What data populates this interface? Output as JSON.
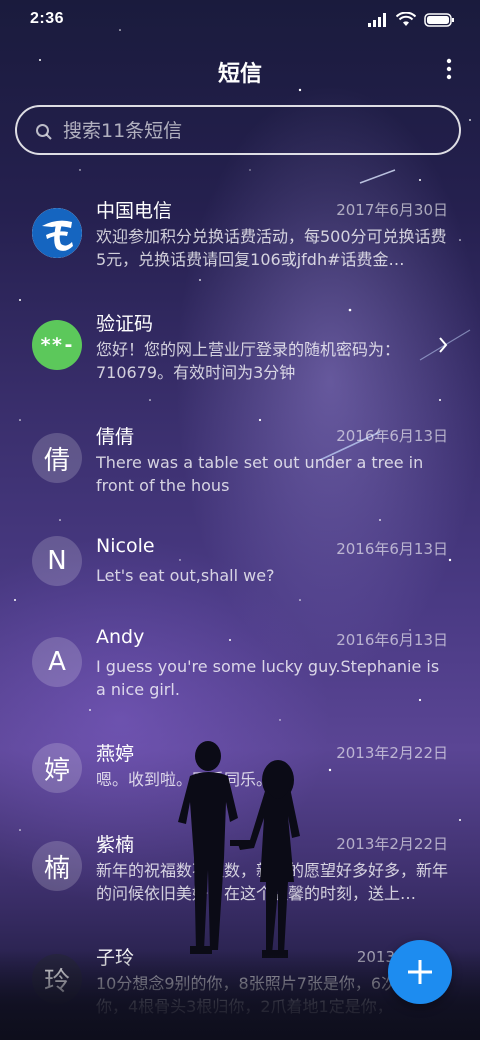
{
  "status_bar": {
    "time": "2:36"
  },
  "header": {
    "title": "短信"
  },
  "search": {
    "placeholder": "搜索11条短信"
  },
  "conversations": [
    {
      "name": "中国电信",
      "date": "2017年6月30日",
      "preview": "欢迎参加积分兑换话费活动，每500分可兑换话费5元，兑换话费请回复106或jfdh#话费金…",
      "avatar_icon": "china-telecom-logo"
    },
    {
      "name": "验证码",
      "date": "",
      "preview": "您好！您的网上营业厅登录的随机密码为：710679。有效时间为3分钟",
      "avatar_text": "**-"
    },
    {
      "name": "倩倩",
      "date": "2016年6月13日",
      "preview": "There was a table set out under a tree in front of the hous",
      "avatar_text": "倩"
    },
    {
      "name": "Nicole",
      "date": "2016年6月13日",
      "preview": "Let's eat out,shall we?",
      "avatar_text": "N"
    },
    {
      "name": "Andy",
      "date": "2016年6月13日",
      "preview": "I guess you're some lucky guy.Stephanie is a nice girl.",
      "avatar_text": "A"
    },
    {
      "name": "燕婷",
      "date": "2013年2月22日",
      "preview": "嗯。收到啦。同乐同乐。",
      "avatar_text": "婷"
    },
    {
      "name": "紫楠",
      "date": "2013年2月22日",
      "preview": "新年的祝福数不胜数，新年的愿望好多好多，新年的问候依旧美好，在这个温馨的时刻，送上…",
      "avatar_text": "楠"
    },
    {
      "name": "子玲",
      "date": "2013年",
      "preview": "10分想念9别的你，8张照片7张是你，6次…只像你，4根骨头3根归你，2爪着地1定是你，",
      "avatar_text": "玲"
    }
  ],
  "colors": {
    "fab": "#1d8cf0",
    "verify_avatar": "#5cc85b",
    "telecom_blue": "#1565c0"
  },
  "icons": [
    "search-icon",
    "more-vertical-icon",
    "chevron-right-icon",
    "plus-icon",
    "signal-icon",
    "wifi-icon",
    "battery-icon"
  ]
}
